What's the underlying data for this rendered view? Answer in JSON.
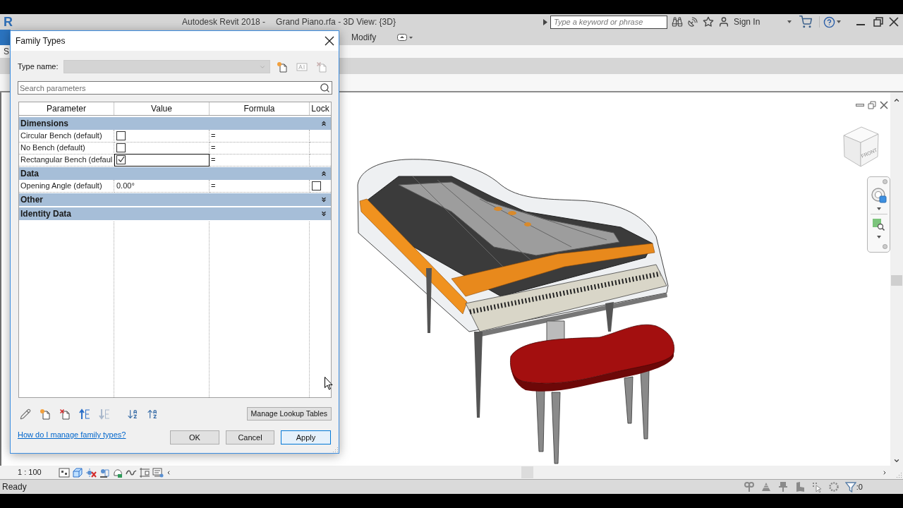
{
  "app": {
    "logo": "R",
    "title": "Autodesk Revit 2018 -",
    "document": "Grand Piano.rfa - 3D View: {3D}",
    "search": {
      "placeholder": "Type a keyword or phrase"
    },
    "sign_in": "Sign In"
  },
  "ribbon": {
    "tabs": [
      "Modify"
    ],
    "panel_text": "S"
  },
  "view": {
    "view_cube": {
      "face_label": "FRONT"
    }
  },
  "view_control_bar": {
    "scale": "1 : 100"
  },
  "status_bar": {
    "message": "Ready",
    "filter_count": ":0"
  },
  "dialog": {
    "title": "Family Types",
    "type_name": {
      "label": "Type name:",
      "disabled": true,
      "tools": [
        {
          "kind": "new",
          "disabled": false
        },
        {
          "kind": "rename",
          "disabled": true
        },
        {
          "kind": "delete",
          "disabled": true
        }
      ]
    },
    "search": {
      "placeholder": "Search parameters"
    },
    "table": {
      "columns": [
        "Parameter",
        "Value",
        "Formula",
        "Lock"
      ],
      "groups": [
        {
          "name": "Dimensions",
          "expanded": true,
          "rows": [
            {
              "parameter": "Circular Bench (default)",
              "value": {
                "kind": "checkbox",
                "checked": false
              },
              "formula": "=",
              "selected": false
            },
            {
              "parameter": "No Bench (default)",
              "value": {
                "kind": "checkbox",
                "checked": false
              },
              "formula": "=",
              "selected": false
            },
            {
              "parameter": "Rectangular Bench (defaul",
              "value": {
                "kind": "checkbox",
                "checked": true
              },
              "formula": "=",
              "selected": true
            }
          ]
        },
        {
          "name": "Data",
          "expanded": true,
          "rows": [
            {
              "parameter": "Opening Angle (default)",
              "value": {
                "kind": "text",
                "text": "0.00°"
              },
              "formula": "=",
              "selected": false,
              "lock": {
                "checked": false
              }
            }
          ]
        },
        {
          "name": "Other",
          "expanded": false
        },
        {
          "name": "Identity Data",
          "expanded": false
        }
      ]
    },
    "tools": [
      {
        "kind": "edit",
        "disabled": false
      },
      {
        "kind": "new",
        "disabled": false
      },
      {
        "kind": "delete",
        "disabled": false
      },
      {
        "kind": "move_up",
        "disabled": false
      },
      {
        "kind": "move_down",
        "disabled": true
      },
      {
        "kind": "sort_ascending",
        "disabled": false
      },
      {
        "kind": "sort_descending",
        "disabled": false
      }
    ],
    "lookup_button": "Manage Lookup Tables",
    "help_link": "How do I manage family types?",
    "buttons": [
      {
        "label": "OK",
        "default": false
      },
      {
        "label": "Cancel",
        "default": false
      },
      {
        "label": "Apply",
        "default": true
      }
    ]
  }
}
